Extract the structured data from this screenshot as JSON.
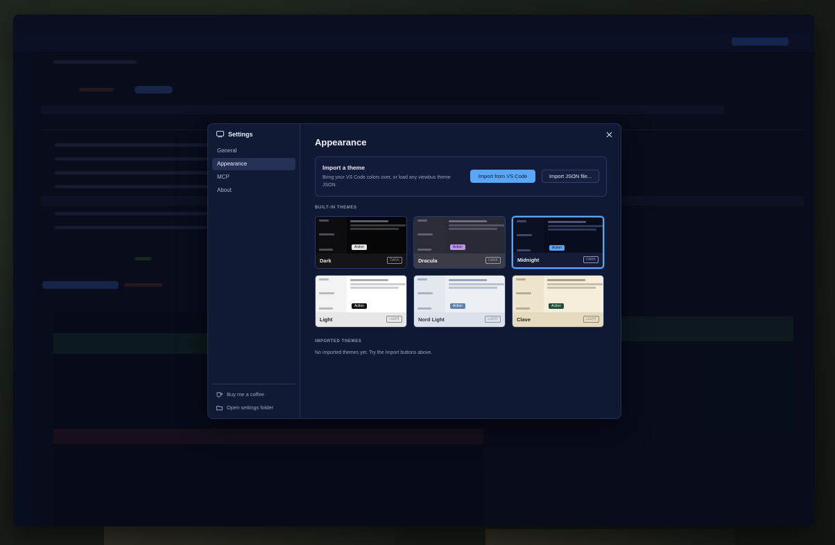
{
  "settings": {
    "header": "Settings",
    "nav": [
      "General",
      "Appearance",
      "MCP",
      "About"
    ],
    "active_nav": "Appearance",
    "footer": {
      "coffee": "Buy me a coffee",
      "folder": "Open settings folder"
    }
  },
  "appearance": {
    "title": "Appearance",
    "import": {
      "title": "Import a theme",
      "description": "Bring your VS Code colors over, or load any viewbus theme JSON.",
      "vscode_button": "Import from VS Code",
      "json_button": "Import JSON file..."
    },
    "builtin_label": "BUILT-IN THEMES",
    "imported_label": "IMPORTED THEMES",
    "no_imported": "No imported themes yet. Try the Import buttons above.",
    "themes": [
      {
        "name": "Dark",
        "mode": "DARK",
        "action": "Action",
        "selected": false,
        "colors": {
          "side": "#0d0d0f",
          "main": "#060607",
          "footer": "#141416",
          "bar": "#5c5f66",
          "text": "#e6e6e6",
          "badge": "#8a8d94",
          "action_bg": "#e6e6e6",
          "action_fg": "#111111"
        }
      },
      {
        "name": "Dracula",
        "mode": "DARK",
        "action": "Action",
        "selected": false,
        "colors": {
          "side": "#2b2c36",
          "main": "#282a36",
          "footer": "#3a3c48",
          "bar": "#6c6f84",
          "text": "#f0f0f2",
          "badge": "#9a9caa",
          "action_bg": "#bd93f9",
          "action_fg": "#1b1b24"
        }
      },
      {
        "name": "Midnight",
        "mode": "DARK",
        "action": "Action",
        "selected": true,
        "colors": {
          "side": "#0b1022",
          "main": "#080d1e",
          "footer": "#141c38",
          "bar": "#4a5578",
          "text": "#e6ecf8",
          "badge": "#8a96b6",
          "action_bg": "#5aa8f5",
          "action_fg": "#0d1730"
        }
      },
      {
        "name": "Light",
        "mode": "LIGHT",
        "action": "Action",
        "selected": false,
        "colors": {
          "side": "#f3f3f3",
          "main": "#ffffff",
          "footer": "#e7e7e7",
          "bar": "#a9abb0",
          "text": "#222222",
          "badge": "#888a90",
          "action_bg": "#111111",
          "action_fg": "#ffffff"
        }
      },
      {
        "name": "Nord Light",
        "mode": "LIGHT",
        "action": "Action",
        "selected": false,
        "colors": {
          "side": "#e3e7ee",
          "main": "#eceff4",
          "footer": "#dde2ea",
          "bar": "#9aa4b6",
          "text": "#2e3440",
          "badge": "#8a93a5",
          "action_bg": "#5e81ac",
          "action_fg": "#ffffff"
        }
      },
      {
        "name": "Clave",
        "mode": "LIGHT",
        "action": "Action",
        "selected": false,
        "colors": {
          "side": "#efe4cc",
          "main": "#f6eedb",
          "footer": "#e6dabf",
          "bar": "#a79f8a",
          "text": "#2b2a25",
          "badge": "#8f8876",
          "action_bg": "#1f4f3a",
          "action_fg": "#f2ecd8"
        }
      }
    ]
  }
}
